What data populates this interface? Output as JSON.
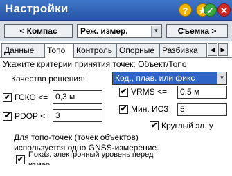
{
  "window": {
    "title": "Настройки",
    "buttons": {
      "help": "?",
      "star": "★",
      "ok": "✓",
      "close": "✕"
    }
  },
  "nav": {
    "back_label": "< Компас",
    "mode_value": "Реж. измер.",
    "next_label": "Съемка >"
  },
  "tabs": [
    {
      "label": "Данные"
    },
    {
      "label": "Топо"
    },
    {
      "label": "Контроль"
    },
    {
      "label": "Опорные"
    },
    {
      "label": "Разбивка"
    }
  ],
  "panel": {
    "instruction": "Укажите критерии принятия точек: Объект/Топо",
    "solution_quality_label": "Качество решения:",
    "solution_quality_value": "Код., плав. или фикс",
    "gsko_label": "ГСКО <=",
    "gsko_value": "0,3 м",
    "pdop_label": "PDOP <=",
    "pdop_value": "3",
    "vrms_label": "VRMS <=",
    "vrms_value": "0,5 м",
    "min_ics_label": "Мин. ИСЗ",
    "min_ics_value": "5",
    "round_label": "Круглый эл. у",
    "note_line1": "Для топо-точек (точек объектов)",
    "note_line2": "используется одно GNSS-измерение.",
    "show_level_line1": "Показ. электронный уровень перед",
    "show_level_line2": "измер."
  },
  "colors": {
    "titlebar": "#2f62b6",
    "selection": "#2e64c5"
  }
}
